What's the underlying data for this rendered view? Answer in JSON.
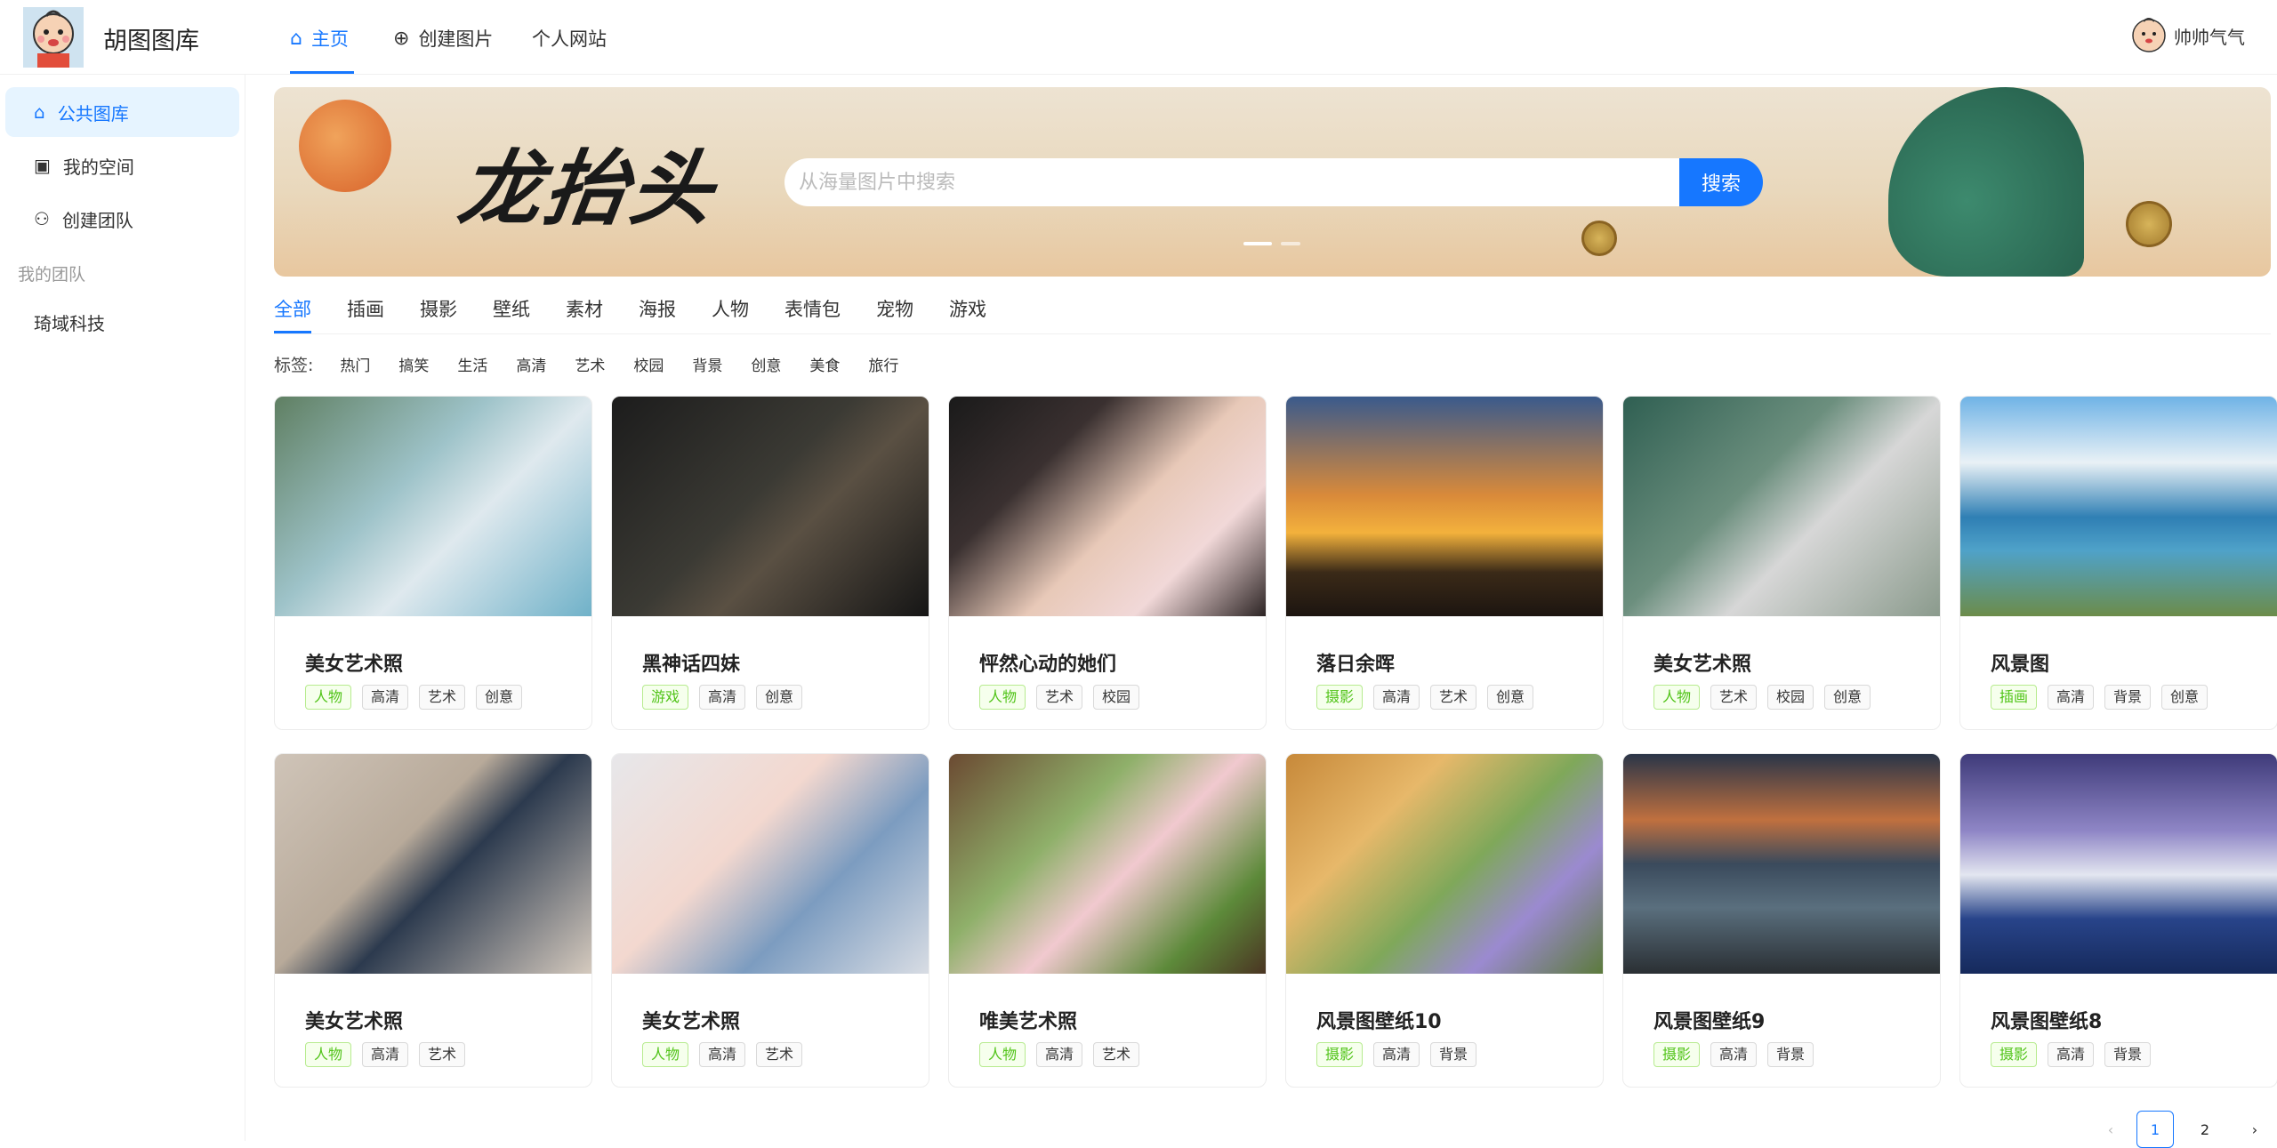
{
  "header": {
    "brand": "胡图图库",
    "nav": [
      {
        "label": "主页",
        "icon": "home-icon",
        "active": true
      },
      {
        "label": "创建图片",
        "icon": "plus-circle-icon"
      },
      {
        "label": "个人网站",
        "icon": ""
      }
    ],
    "user": {
      "name": "帅帅气气"
    }
  },
  "sidebar": {
    "items": [
      {
        "label": "公共图库",
        "icon": "home-icon",
        "active": true
      },
      {
        "label": "我的空间",
        "icon": "user-card-icon"
      },
      {
        "label": "创建团队",
        "icon": "team-icon"
      }
    ],
    "group_title": "我的团队",
    "group_items": [
      {
        "label": "琦域科技"
      }
    ]
  },
  "banner": {
    "title": "龙抬头",
    "search_placeholder": "从海量图片中搜索",
    "search_button": "搜索"
  },
  "categories": [
    "全部",
    "插画",
    "摄影",
    "壁纸",
    "素材",
    "海报",
    "人物",
    "表情包",
    "宠物",
    "游戏"
  ],
  "tags": {
    "label": "标签:",
    "items": [
      "热门",
      "搞笑",
      "生活",
      "高清",
      "艺术",
      "校园",
      "背景",
      "创意",
      "美食",
      "旅行"
    ]
  },
  "cards": [
    {
      "title": "美女艺术照",
      "tags": [
        "人物",
        "高清",
        "艺术",
        "创意"
      ]
    },
    {
      "title": "黑神话四妹",
      "tags": [
        "游戏",
        "高清",
        "创意"
      ]
    },
    {
      "title": "怦然心动的她们",
      "tags": [
        "人物",
        "艺术",
        "校园"
      ]
    },
    {
      "title": "落日余晖",
      "tags": [
        "摄影",
        "高清",
        "艺术",
        "创意"
      ]
    },
    {
      "title": "美女艺术照",
      "tags": [
        "人物",
        "艺术",
        "校园",
        "创意"
      ]
    },
    {
      "title": "风景图",
      "tags": [
        "插画",
        "高清",
        "背景",
        "创意"
      ]
    },
    {
      "title": "美女艺术照",
      "tags": [
        "人物",
        "高清",
        "艺术"
      ]
    },
    {
      "title": "美女艺术照",
      "tags": [
        "人物",
        "高清",
        "艺术"
      ]
    },
    {
      "title": "唯美艺术照",
      "tags": [
        "人物",
        "高清",
        "艺术"
      ]
    },
    {
      "title": "风景图壁纸10",
      "tags": [
        "摄影",
        "高清",
        "背景"
      ]
    },
    {
      "title": "风景图壁纸9",
      "tags": [
        "摄影",
        "高清",
        "背景"
      ]
    },
    {
      "title": "风景图壁纸8",
      "tags": [
        "摄影",
        "高清",
        "背景"
      ]
    }
  ],
  "pagination": {
    "pages": [
      "1",
      "2"
    ],
    "current": "1"
  },
  "colors": {
    "accent": "#1677ff",
    "category_tag": "#52c41a"
  }
}
